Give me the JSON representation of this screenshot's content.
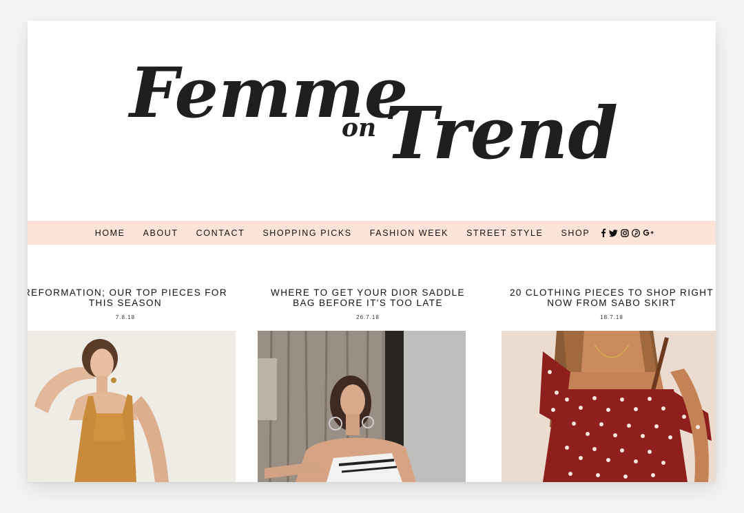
{
  "site": {
    "logo_word_1": "Femme",
    "logo_word_2": "on",
    "logo_word_3": "Trend"
  },
  "nav": {
    "items": [
      "HOME",
      "ABOUT",
      "CONTACT",
      "SHOPPING PICKS",
      "FASHION WEEK",
      "STREET STYLE",
      "SHOP"
    ],
    "social_icons": [
      "facebook-icon",
      "twitter-icon",
      "instagram-icon",
      "pinterest-icon",
      "google-plus-icon"
    ],
    "background": "#fde3d8"
  },
  "posts": [
    {
      "title": "REFORMATION; OUR TOP PIECES FOR THIS SEASON",
      "date": "7.8.18"
    },
    {
      "title": "WHERE TO GET YOUR DIOR SADDLE BAG BEFORE IT'S TOO LATE",
      "date": "26.7.18"
    },
    {
      "title": "20 CLOTHING PIECES TO SHOP RIGHT NOW FROM SABO SKIRT",
      "date": "18.7.18"
    }
  ]
}
